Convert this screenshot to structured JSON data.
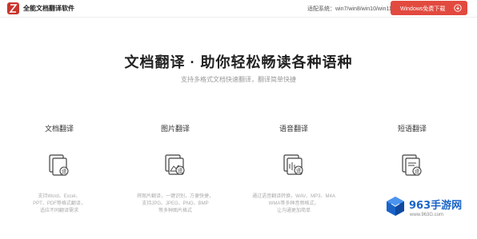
{
  "header": {
    "app_name": "全能文档翻译软件",
    "compat_text": "适配系统：win7/win8/win10/win11",
    "download_button": "Windows免费下载"
  },
  "hero": {
    "title": "文档翻译 · 助你轻松畅读各种语种",
    "subtitle": "支持多格式文档快速翻译，翻译简单快捷"
  },
  "features": [
    {
      "title": "文档翻译",
      "icon": "document-translate-icon",
      "desc": [
        "支持Word、Excel、",
        "PPT、PDF等格式翻译，",
        "适应不同翻译需求"
      ]
    },
    {
      "title": "图片翻译",
      "icon": "image-translate-icon",
      "desc": [
        "将图片翻译，一键识别，方便快捷，",
        "支持JPG、JPEG、PNG、BMP",
        "等多种图片格式"
      ]
    },
    {
      "title": "语音翻译",
      "icon": "voice-translate-icon",
      "desc": [
        "通过语音翻译转换，WAV、MP3、M4A",
        "WMA等多种音频格式，",
        "让沟通更加简单"
      ]
    },
    {
      "title": "短语翻译",
      "icon": "phrase-translate-icon",
      "desc": []
    }
  ],
  "watermark": {
    "brand": "963手游网",
    "url": "www.963G.com",
    "color": "#1a64c8"
  },
  "colors": {
    "accent": "#e24a3f",
    "logo": "#c8352c"
  }
}
